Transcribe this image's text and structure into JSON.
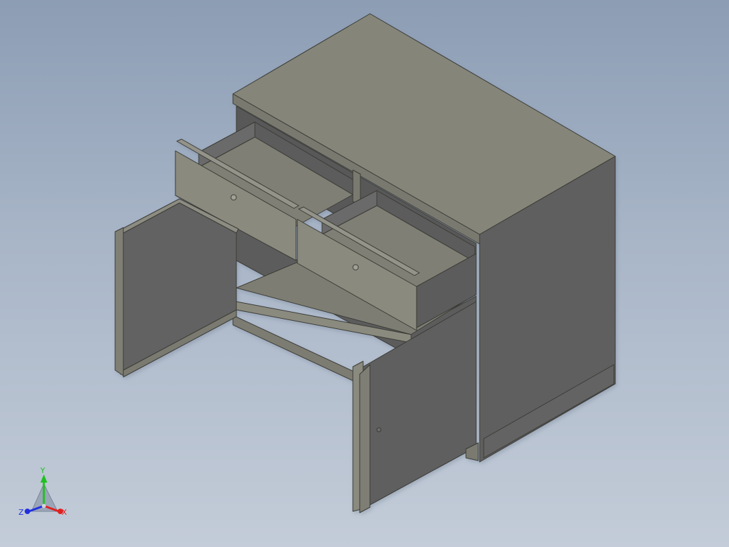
{
  "viewport": {
    "background_top": "#8c9db4",
    "background_bottom": "#c3ccd8"
  },
  "model": {
    "part": "cabinet-with-two-open-drawers-and-two-open-doors",
    "face_colors": {
      "top": "#858579",
      "front_light": "#8a8a7e",
      "side_dark": "#5e5e5e",
      "inner_dark": "#5a5a5a",
      "inner_floor": "#7d7d73",
      "edge": "#3a3a36"
    }
  },
  "triad": {
    "x_label": "X",
    "y_label": "Y",
    "z_label": "Z",
    "x_color": "#e02020",
    "y_color": "#20c020",
    "z_color": "#2030e0"
  }
}
